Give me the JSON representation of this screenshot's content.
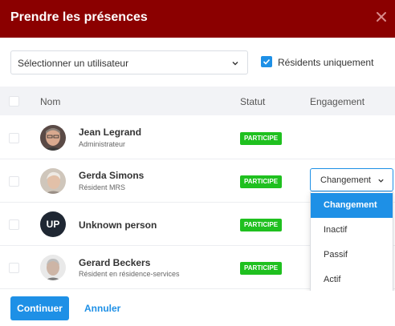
{
  "modal": {
    "title": "Prendre les présences"
  },
  "filters": {
    "user_select_label": "Sélectionner un utilisateur",
    "residents_only_label": "Résidents uniquement",
    "residents_only_checked": true
  },
  "table": {
    "columns": [
      "Nom",
      "Statut",
      "Engagement"
    ],
    "rows": [
      {
        "name": "Jean Legrand",
        "role": "Administrateur",
        "status": "PARTICIPE",
        "avatar": "photo"
      },
      {
        "name": "Gerda Simons",
        "role": "Résident MRS",
        "status": "PARTICIPE",
        "avatar": "photo",
        "engagement": "Changement"
      },
      {
        "name": "Unknown person",
        "role": "",
        "status": "PARTICIPE",
        "avatar": "initials",
        "initials": "UP"
      },
      {
        "name": "Gerard Beckers",
        "role": "Résident en résidence-services",
        "status": "PARTICIPE",
        "avatar": "photo"
      }
    ]
  },
  "engagement_dropdown": {
    "current": "Changement",
    "options": [
      "Changement",
      "Inactif",
      "Passif",
      "Actif"
    ],
    "highlighted": "Changement"
  },
  "footer": {
    "continue_label": "Continuer",
    "cancel_label": "Annuler"
  },
  "colors": {
    "header": "#8b0000",
    "accent": "#1e90e6",
    "badge": "#1fc01f"
  }
}
